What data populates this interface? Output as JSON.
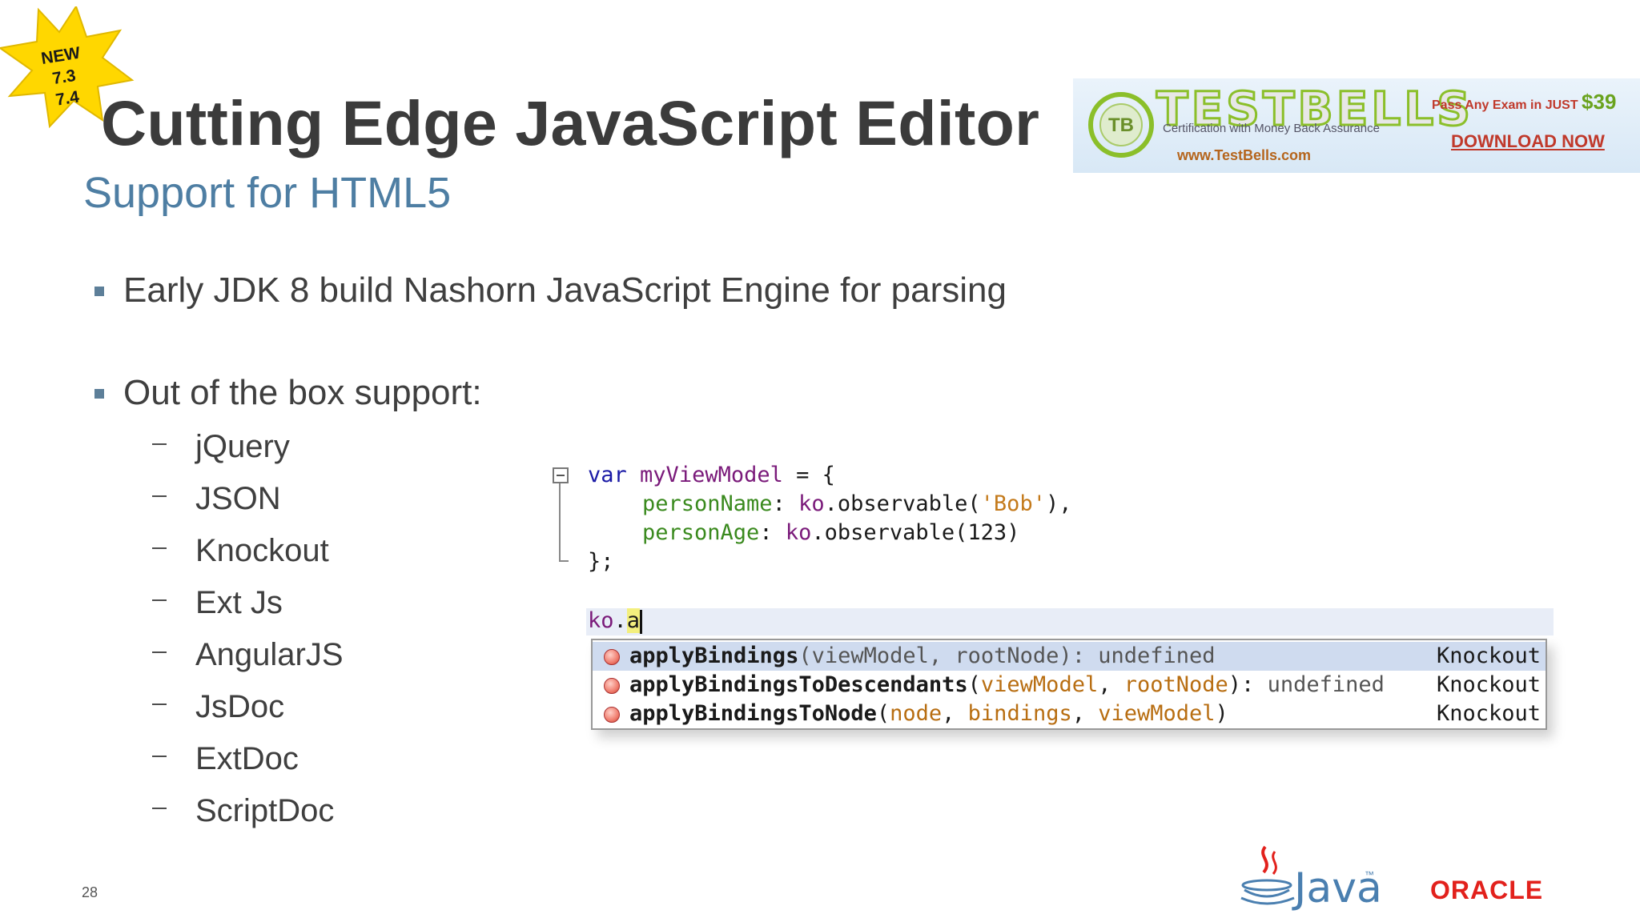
{
  "badge": {
    "line1": "NEW",
    "line2": "7.3",
    "line3": "7.4",
    "color": "#ffd700"
  },
  "title": "Cutting Edge JavaScript Editor",
  "subtitle": "Support for HTML5",
  "ad": {
    "brand": "TESTBELLS",
    "tagline": "Certification with Money Back Assurance",
    "url": "www.TestBells.com",
    "pass_text": "Pass Any Exam in JUST ",
    "price": "$39",
    "download": "DOWNLOAD NOW",
    "logo_text": "TB"
  },
  "bullets": [
    "Early JDK 8 build Nashorn JavaScript Engine for parsing",
    "Out of the box support:"
  ],
  "support_items": [
    "jQuery",
    "JSON",
    "Knockout",
    "Ext Js",
    "AngularJS",
    "JsDoc",
    "ExtDoc",
    "ScriptDoc"
  ],
  "code": {
    "l1_kw": "var",
    "l1_var": "myViewModel",
    "l1_rest": " = {",
    "l2_prop": "personName",
    "l2_obj": "ko",
    "l2_mid": ".observable(",
    "l2_str": "'Bob'",
    "l2_end": "),",
    "l3_prop": "personAge",
    "l3_obj": "ko",
    "l3_mid": ".observable(123)",
    "l4": "};",
    "input_obj": "ko",
    "input_dot": ".",
    "input_typed": "a"
  },
  "completions": [
    {
      "name": "applyBindings",
      "params": "(viewModel, rootNode): undefined",
      "library": "Knockout"
    },
    {
      "name": "applyBindingsToDescendants",
      "p_open": "(",
      "p1": "viewModel",
      "sep": ", ",
      "p2": "rootNode",
      "p_close": "): ",
      "ret": "undefined",
      "library": "Knockout"
    },
    {
      "name": "applyBindingsToNode",
      "p_open": "(",
      "p1": "node",
      "sep1": ", ",
      "p2": "bindings",
      "sep2": ", ",
      "p3": "viewModel",
      "p_close": ")",
      "library": "Knockout"
    }
  ],
  "page_number": "28",
  "footer": {
    "java": "Java",
    "java_tm": "™",
    "oracle": "ORACLE"
  }
}
